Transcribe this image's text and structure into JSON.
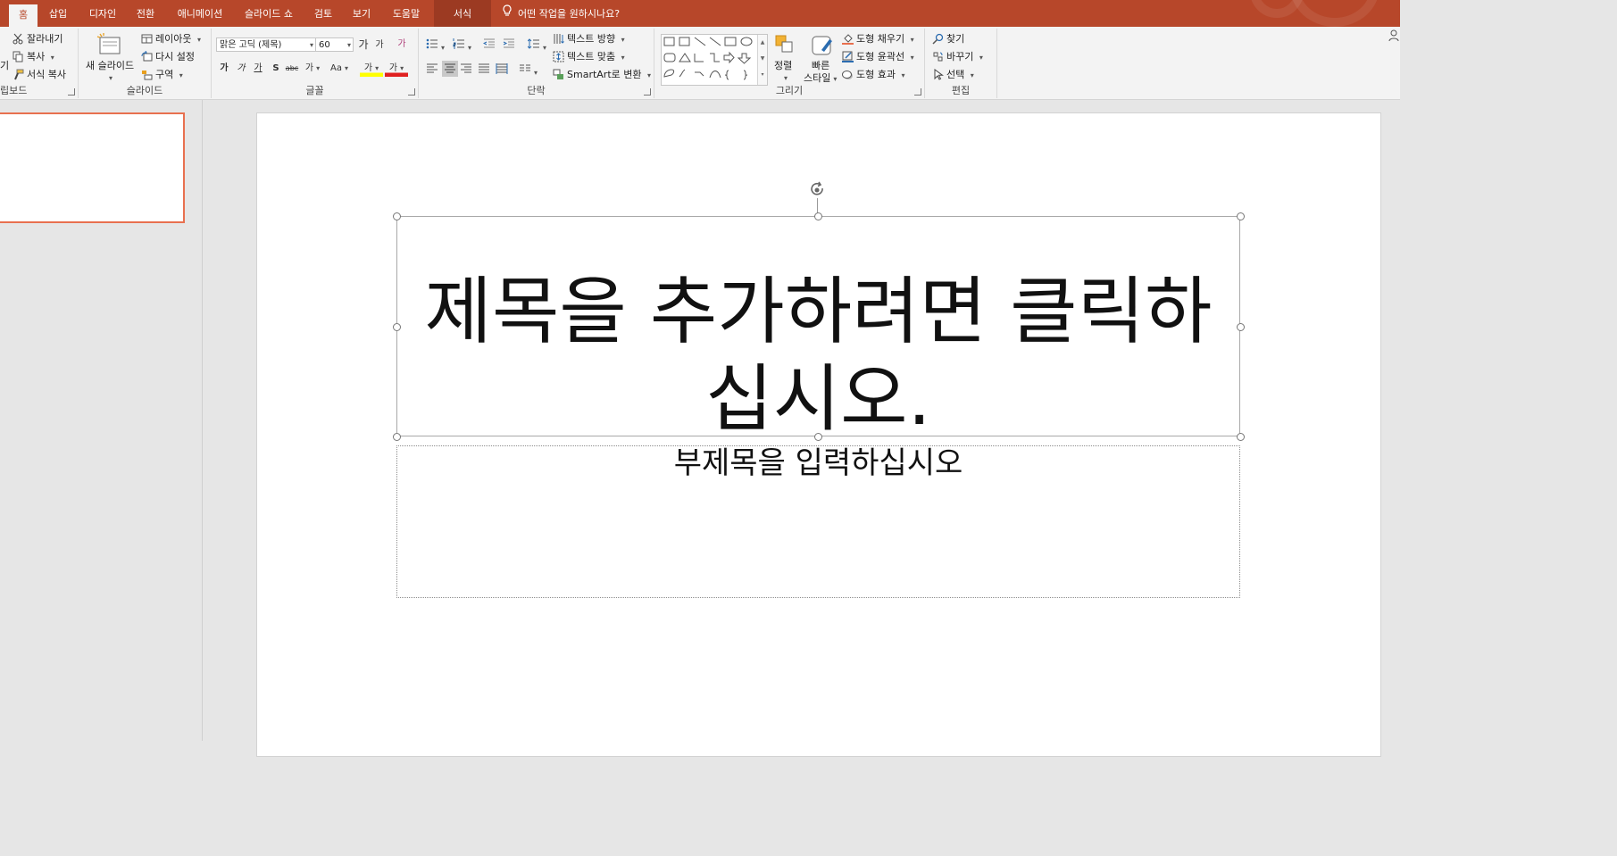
{
  "tabs": {
    "home": "홈",
    "insert": "삽입",
    "design": "디자인",
    "transitions": "전환",
    "animations": "애니메이션",
    "slideshow": "슬라이드 쇼",
    "review": "검토",
    "view": "보기",
    "help": "도움말",
    "format": "서식"
  },
  "tell_me": "어떤 작업을 원하시나요?",
  "clipboard": {
    "cut": "잘라내기",
    "copy": "복사",
    "format_painter": "서식 복사",
    "paste_fragment": "기",
    "label": "립보드"
  },
  "slides": {
    "new_slide": "새 슬라이드",
    "layout": "레이아웃",
    "reset": "다시 설정",
    "section": "구역",
    "label": "슬라이드"
  },
  "font": {
    "family": "맑은 고딕 (제목)",
    "size": "60",
    "grow": "가",
    "shrink": "가",
    "clear": "가",
    "bold": "가",
    "italic": "가",
    "underline": "가",
    "shadow": "S",
    "strikethrough": "abc",
    "spacing": "가",
    "case": "Aa",
    "highlight": "가",
    "color": "가",
    "label": "글꼴"
  },
  "paragraph": {
    "text_direction": "텍스트 방향",
    "align_text": "텍스트 맞춤",
    "smartart": "SmartArt로 변환",
    "label": "단락"
  },
  "drawing": {
    "arrange": "정렬",
    "quick_styles_1": "빠른",
    "quick_styles_2": "스타일",
    "shape_fill": "도형 채우기",
    "shape_outline": "도형 윤곽선",
    "shape_effects": "도형 효과",
    "label": "그리기"
  },
  "editing": {
    "find": "찾기",
    "replace": "바꾸기",
    "select": "선택",
    "label": "편집"
  },
  "slide": {
    "title": "제목을 추가하려면 클릭하십시오.",
    "subtitle": "부제목을 입력하십시오"
  },
  "colors": {
    "accent": "#b7472a",
    "thumb_border": "#e8704f"
  }
}
